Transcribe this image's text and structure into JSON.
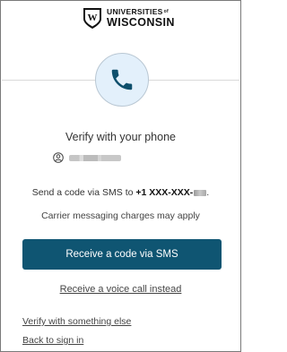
{
  "logo": {
    "line1": "UNIVERSITIES",
    "of": "of",
    "line2": "WISCONSIN",
    "shield_letter": "W"
  },
  "icons": {
    "phone": "phone-icon",
    "user": "user-circle-icon"
  },
  "colors": {
    "primary_button": "#0f5572",
    "badge_bg": "#e3f0fb",
    "phone_icon": "#0e4f6c"
  },
  "main": {
    "heading": "Verify with your phone",
    "sms_prefix": "Send a code via SMS to ",
    "phone_number": "+1 XXX-XXX-",
    "carrier_note": "Carrier messaging charges may apply",
    "sms_button": "Receive a code via SMS",
    "voice_link": "Receive a voice call instead"
  },
  "footer": {
    "verify_else": "Verify with something else",
    "back_to_signin": "Back to sign in"
  }
}
